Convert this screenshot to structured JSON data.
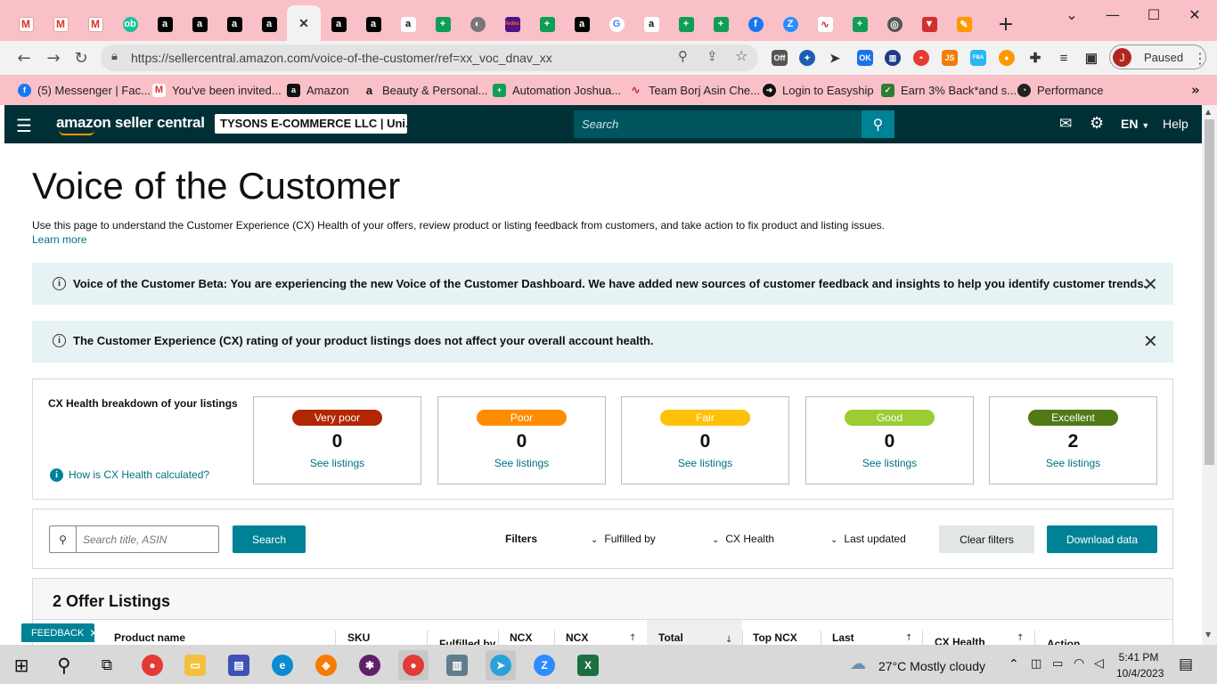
{
  "browser": {
    "tabs": [
      {
        "icon": "gmail-icon",
        "glyph": "M"
      },
      {
        "icon": "gmail-icon",
        "glyph": "M"
      },
      {
        "icon": "gmail-icon",
        "glyph": "M"
      },
      {
        "icon": "grammarly-icon",
        "glyph": "ob"
      },
      {
        "icon": "amazon-icon",
        "glyph": "a"
      },
      {
        "icon": "amazon-icon",
        "glyph": "a"
      },
      {
        "icon": "amazon-icon",
        "glyph": "a"
      },
      {
        "icon": "amazon-icon",
        "glyph": "a"
      },
      {
        "icon": "close-icon",
        "glyph": "✕",
        "active": true
      },
      {
        "icon": "amazon-icon",
        "glyph": "a"
      },
      {
        "icon": "amazon-icon",
        "glyph": "a"
      },
      {
        "icon": "amazon-smile-icon",
        "glyph": "a"
      },
      {
        "icon": "sheets-icon",
        "glyph": "+"
      },
      {
        "icon": "globe-icon",
        "glyph": "◐"
      },
      {
        "icon": "fedex-icon",
        "glyph": "fedex"
      },
      {
        "icon": "sheets-icon",
        "glyph": "+"
      },
      {
        "icon": "amazon-icon",
        "glyph": "a"
      },
      {
        "icon": "google-icon",
        "glyph": "G"
      },
      {
        "icon": "amazon-smile-icon",
        "glyph": "a"
      },
      {
        "icon": "sheets-icon",
        "glyph": "+"
      },
      {
        "icon": "sheets-icon",
        "glyph": "+"
      },
      {
        "icon": "facebook-icon",
        "glyph": "f"
      },
      {
        "icon": "zoom-icon",
        "glyph": "Z"
      },
      {
        "icon": "chart-icon",
        "glyph": "∿"
      },
      {
        "icon": "sheets-icon",
        "glyph": "+"
      },
      {
        "icon": "chrome-icon",
        "glyph": "◎"
      },
      {
        "icon": "vpn-icon",
        "glyph": "▼"
      },
      {
        "icon": "app-icon",
        "glyph": "✎"
      }
    ],
    "new_tab": "+",
    "url": "https://sellercentral.amazon.com/voice-of-the-customer/ref=xx_voc_dnav_xx",
    "profile_initial": "J",
    "profile_status": "Paused",
    "bookmarks": [
      {
        "icon": "facebook-icon",
        "label": "(5) Messenger | Fac..."
      },
      {
        "icon": "gmail-icon",
        "label": "You've been invited..."
      },
      {
        "icon": "amazon-icon",
        "label": "Amazon"
      },
      {
        "icon": "amazon-smile-icon",
        "label": "Beauty & Personal..."
      },
      {
        "icon": "sheets-icon",
        "label": "Automation Joshua..."
      },
      {
        "icon": "chart-icon",
        "label": "Team Borj Asin Che..."
      },
      {
        "icon": "easyship-icon",
        "label": "Login to Easyship"
      },
      {
        "icon": "cashback-icon",
        "label": "Earn 3% Back*and s..."
      },
      {
        "icon": "performance-icon",
        "label": "Performance"
      }
    ]
  },
  "amazon_header": {
    "logo": "amazon seller central",
    "account": "TYSONS E-COMMERCE LLC | Uni...",
    "search_placeholder": "Search",
    "language": "EN",
    "help": "Help"
  },
  "page": {
    "title": "Voice of the Customer",
    "description": "Use this page to understand the Customer Experience (CX) Health of your offers, review product or listing feedback from customers, and take action to fix product and listing issues.",
    "learn_more": "Learn more",
    "banner1": "Voice of the Customer Beta: You are experiencing the new Voice of the Customer Dashboard. We have added new sources of customer feedback and insights to help you identify customer trends.",
    "banner2": "The Customer Experience (CX) rating of your product listings does not affect your overall account health.",
    "cx_heading": "CX Health breakdown of your listings",
    "cx_help": "How is CX Health calculated?",
    "cx_cards": [
      {
        "label": "Very poor",
        "count": "0",
        "link": "See listings",
        "color": "#b12704"
      },
      {
        "label": "Poor",
        "count": "0",
        "link": "See listings",
        "color": "#ff8c00"
      },
      {
        "label": "Fair",
        "count": "0",
        "link": "See listings",
        "color": "#ffc107"
      },
      {
        "label": "Good",
        "count": "0",
        "link": "See listings",
        "color": "#9acd32"
      },
      {
        "label": "Excellent",
        "count": "2",
        "link": "See listings",
        "color": "#4f7a16"
      }
    ],
    "filters": {
      "search_placeholder": "Search title, ASIN",
      "search_button": "Search",
      "filters_label": "Filters",
      "fulfilled_by": "Fulfilled by",
      "cx_health": "CX Health",
      "last_updated": "Last updated",
      "clear": "Clear filters",
      "download": "Download data"
    },
    "listings_title": "2 Offer Listings",
    "columns": [
      "Product name",
      "SKU",
      "Fulfilled by",
      "NCX",
      "NCX",
      "Total",
      "Top NCX",
      "Last",
      "CX Health",
      "Action"
    ],
    "feedback": "FEEDBACK"
  },
  "taskbar": {
    "weather": "27°C  Mostly cloudy",
    "time": "5:41 PM",
    "date": "10/4/2023"
  }
}
